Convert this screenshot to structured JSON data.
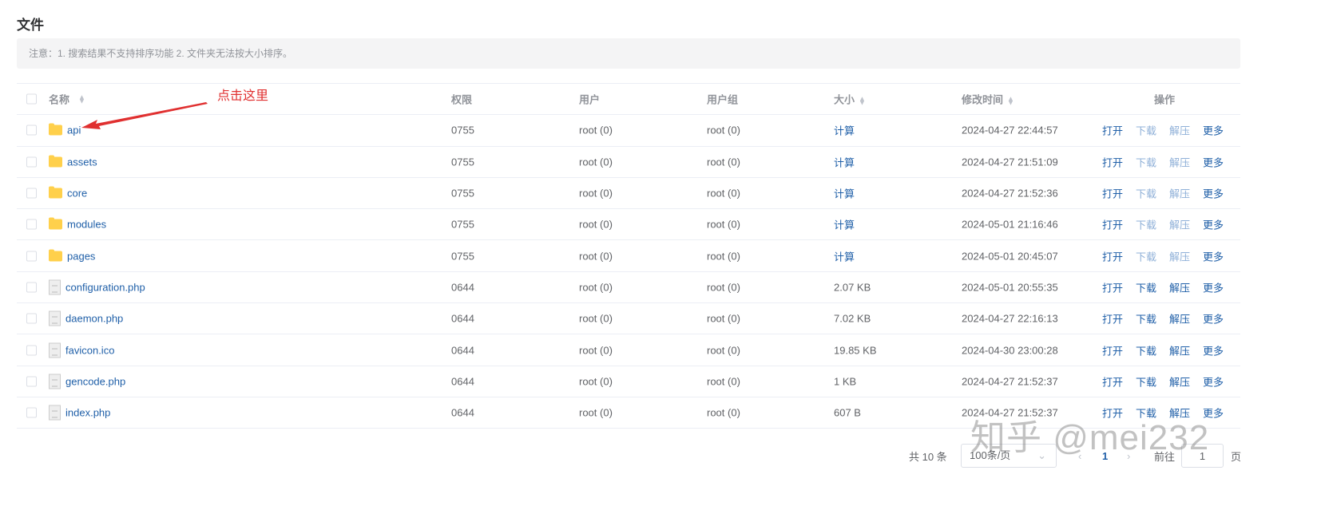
{
  "title": "文件",
  "notice": "注意：1. 搜索结果不支持排序功能 2. 文件夹无法按大小排序。",
  "annotation": "点击这里",
  "columns": {
    "name": "名称",
    "perm": "权限",
    "user": "用户",
    "group": "用户组",
    "size": "大小",
    "time": "修改时间",
    "ops": "操作"
  },
  "ops": {
    "open": "打开",
    "download": "下载",
    "extract": "解压",
    "more": "更多"
  },
  "rows": [
    {
      "type": "folder",
      "name": "api",
      "perm": "0755",
      "user": "root (0)",
      "group": "root (0)",
      "size": "计算",
      "time": "2024-04-27 22:44:57"
    },
    {
      "type": "folder",
      "name": "assets",
      "perm": "0755",
      "user": "root (0)",
      "group": "root (0)",
      "size": "计算",
      "time": "2024-04-27 21:51:09"
    },
    {
      "type": "folder",
      "name": "core",
      "perm": "0755",
      "user": "root (0)",
      "group": "root (0)",
      "size": "计算",
      "time": "2024-04-27 21:52:36"
    },
    {
      "type": "folder",
      "name": "modules",
      "perm": "0755",
      "user": "root (0)",
      "group": "root (0)",
      "size": "计算",
      "time": "2024-05-01 21:16:46"
    },
    {
      "type": "folder",
      "name": "pages",
      "perm": "0755",
      "user": "root (0)",
      "group": "root (0)",
      "size": "计算",
      "time": "2024-05-01 20:45:07"
    },
    {
      "type": "file",
      "name": "configuration.php",
      "perm": "0644",
      "user": "root (0)",
      "group": "root (0)",
      "size": "2.07 KB",
      "time": "2024-05-01 20:55:35"
    },
    {
      "type": "file",
      "name": "daemon.php",
      "perm": "0644",
      "user": "root (0)",
      "group": "root (0)",
      "size": "7.02 KB",
      "time": "2024-04-27 22:16:13"
    },
    {
      "type": "file",
      "name": "favicon.ico",
      "perm": "0644",
      "user": "root (0)",
      "group": "root (0)",
      "size": "19.85 KB",
      "time": "2024-04-30 23:00:28"
    },
    {
      "type": "file",
      "name": "gencode.php",
      "perm": "0644",
      "user": "root (0)",
      "group": "root (0)",
      "size": "1 KB",
      "time": "2024-04-27 21:52:37"
    },
    {
      "type": "file",
      "name": "index.php",
      "perm": "0644",
      "user": "root (0)",
      "group": "root (0)",
      "size": "607 B",
      "time": "2024-04-27 21:52:37"
    }
  ],
  "pagination": {
    "total": "共 10 条",
    "page_size": "100条/页",
    "current": "1",
    "goto_label": "前往",
    "goto_value": "1",
    "page_suffix": "页"
  },
  "watermark": "知乎 @mei232",
  "colors": {
    "link": "#1f5fa8",
    "folder": "#ffd04b",
    "annotation": "#e03030"
  }
}
